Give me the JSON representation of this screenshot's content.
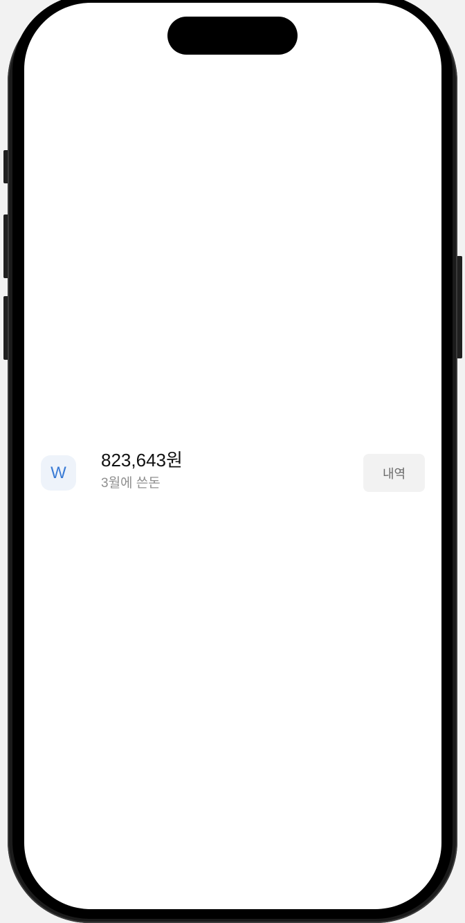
{
  "spending": {
    "icon_letter": "W",
    "icon": "won-icon",
    "amount": "823,643원",
    "caption": "3월에 쓴돈",
    "history_button_label": "내역"
  },
  "colors": {
    "screen_background": "#ffffff",
    "icon_background": "#eef3fa",
    "icon_accent": "#3a7bd5",
    "amount_text": "#111111",
    "caption_text": "#8f8f8f",
    "button_background": "#f2f2f2",
    "button_text": "#6b6b6b"
  }
}
